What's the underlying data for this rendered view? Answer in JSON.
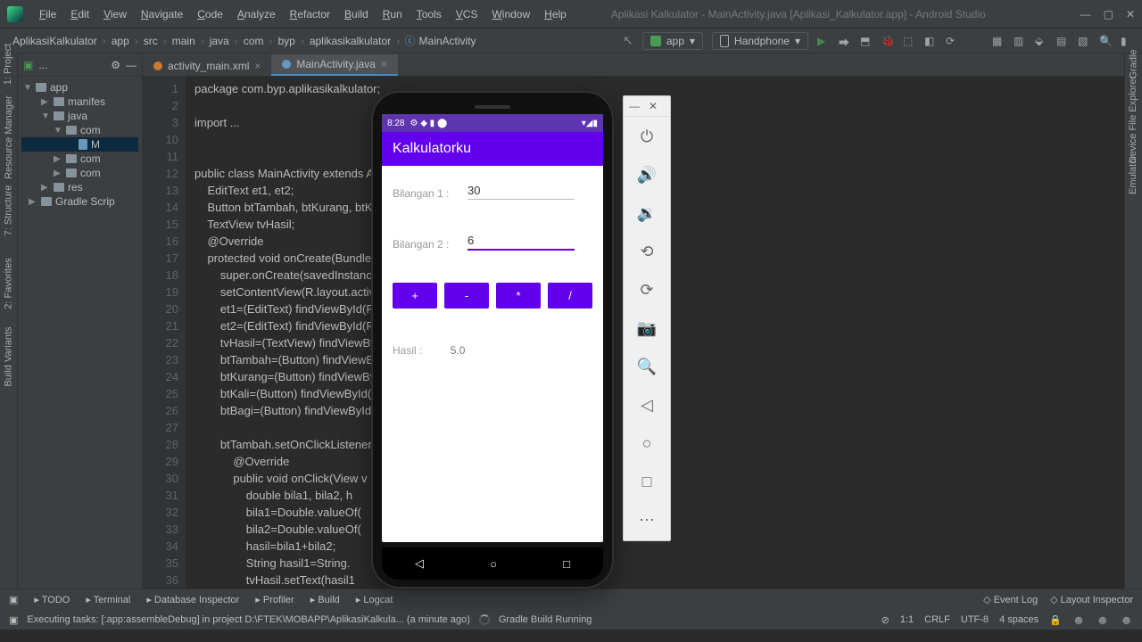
{
  "menu": {
    "items": [
      "File",
      "Edit",
      "View",
      "Navigate",
      "Code",
      "Analyze",
      "Refactor",
      "Build",
      "Run",
      "Tools",
      "VCS",
      "Window",
      "Help"
    ]
  },
  "window_title": "Aplikasi Kalkulator - MainActivity.java [Aplikasi_Kalkulator.app] - Android Studio",
  "breadcrumb": [
    "AplikasiKalkulator",
    "app",
    "src",
    "main",
    "java",
    "com",
    "byp",
    "aplikasikalkulator",
    "MainActivity"
  ],
  "run_config": "app",
  "device_config": "Handphone",
  "project": {
    "root": "app",
    "items": [
      {
        "label": "manifes",
        "depth": 1,
        "expand": "▶"
      },
      {
        "label": "java",
        "depth": 1,
        "expand": "▼",
        "sel": false
      },
      {
        "label": "com",
        "depth": 2,
        "expand": "▼"
      },
      {
        "label": "M",
        "depth": 3,
        "file": true,
        "sel": true
      },
      {
        "label": "com",
        "depth": 2,
        "expand": "▶"
      },
      {
        "label": "com",
        "depth": 2,
        "expand": "▶"
      },
      {
        "label": "res",
        "depth": 1,
        "expand": "▶"
      },
      {
        "label": "Gradle Scrip",
        "depth": 0,
        "expand": "▶"
      }
    ]
  },
  "tabs": [
    {
      "label": "activity_main.xml",
      "kind": "x",
      "active": false
    },
    {
      "label": "MainActivity.java",
      "kind": "j",
      "active": true
    }
  ],
  "code": {
    "lines": [
      {
        "n": 1,
        "t": "<kw>package</kw> <pl>com.byp.aplikasikalkulator;</pl>"
      },
      {
        "n": 2,
        "t": ""
      },
      {
        "n": 3,
        "t": "<kw>import</kw> <pl>...</pl>"
      },
      {
        "n": 10,
        "t": ""
      },
      {
        "n": 11,
        "t": ""
      },
      {
        "n": 12,
        "t": "<kw>public class</kw> <ty>MainActivity</ty> <kw>extends</kw> <ty>AppC</ty>"
      },
      {
        "n": 13,
        "t": "    <ty>EditText</ty> <id>et1</id>, <id>et2</id>;"
      },
      {
        "n": 14,
        "t": "    <ty>Button</ty> <id>btTambah</id>, <id>btKurang</id>, <id>btKali</id>"
      },
      {
        "n": 15,
        "t": "    <ty>TextView</ty> <id>tvHasil</id>;"
      },
      {
        "n": 16,
        "t": "    <ann>@Override</ann>"
      },
      {
        "n": 17,
        "t": "    <kw>protected void</kw> <fn>onCreate</fn>(<ty>Bundle</ty> sav"
      },
      {
        "n": 18,
        "t": "        <kw>super</kw>.onCreate(savedInstanceSt"
      },
      {
        "n": 19,
        "t": "        setContentView(R.layout.<id>activ</id>"
      },
      {
        "n": 20,
        "t": "        <id>et1</id>=(<ty>EditText</ty>) findViewById(R."
      },
      {
        "n": 21,
        "t": "        <id>et2</id>=(<ty>EditText</ty>) findViewById(R."
      },
      {
        "n": 22,
        "t": "        <id>tvHasil</id>=(<ty>TextView</ty>) findViewBy"
      },
      {
        "n": 23,
        "t": "        <id>btTambah</id>=(<ty>Button</ty>) findViewByI"
      },
      {
        "n": 24,
        "t": "        <id>btKurang</id>=(<ty>Button</ty>) findViewByI"
      },
      {
        "n": 25,
        "t": "        <id>btKali</id>=(<ty>Button</ty>) findViewById("
      },
      {
        "n": 26,
        "t": "        <id>btBagi</id>=(<ty>Button</ty>) findViewById("
      },
      {
        "n": 27,
        "t": ""
      },
      {
        "n": 28,
        "t": "        <id>btTambah</id>.setOnClickListener(<kw>n</kw>"
      },
      {
        "n": 29,
        "t": "            <ann>@Override</ann>"
      },
      {
        "n": 30,
        "t": "            <kw>public void</kw> <fn>onClick</fn>(<ty>View</ty> v"
      },
      {
        "n": 31,
        "t": "                <kw>double</kw> bila1, bila2, h"
      },
      {
        "n": 32,
        "t": "                bila1=Double.<fn>valueOf</fn>("
      },
      {
        "n": 33,
        "t": "                bila2=Double.<fn>valueOf</fn>("
      },
      {
        "n": 34,
        "t": "                hasil=bila1+bila2;"
      },
      {
        "n": 35,
        "t": "                <ty>String</ty> hasil1=String."
      },
      {
        "n": 36,
        "t": "                <id>tvHasil</id>.setText(hasil1"
      }
    ]
  },
  "emulator": {
    "time": "8:28",
    "app_title": "Kalkulatorku",
    "label1": "Bilangan 1 :",
    "value1": "30",
    "label2": "Bilangan 2 :",
    "value2": "6",
    "btns": [
      "+",
      "-",
      "*",
      "/"
    ],
    "result_label": "Hasil :",
    "result_value": "5.0"
  },
  "sidebar_tools": {
    "back": "◁",
    "home": "○",
    "recent": "□",
    "power": "⏻",
    "vol_up": "🔊",
    "vol_down": "🔉",
    "rotate_l": "⟲",
    "rotate_r": "⟳",
    "camera": "📷",
    "zoom": "🔍",
    "more": "⋯"
  },
  "bottom_tools": [
    "TODO",
    "Terminal",
    "Database Inspector",
    "Profiler",
    "Build",
    "Logcat"
  ],
  "bottom_right": [
    "Event Log",
    "Layout Inspector"
  ],
  "status": {
    "msg": "Executing tasks: [:app:assembleDebug] in project D:\\FTEK\\MOBAPP\\AplikasiKalkula... (a minute ago)",
    "gradle": "Gradle Build Running",
    "pos": "1:1",
    "crlf": "CRLF",
    "enc": "UTF-8",
    "indent": "4 spaces"
  },
  "side_labels": {
    "project": "1: Project",
    "resmgr": "Resource Manager",
    "structure": "7: Structure",
    "favorites": "2: Favorites",
    "buildvar": "Build Variants",
    "gradle": "Gradle",
    "devfile": "Device File Explorer",
    "emul": "Emulator"
  }
}
